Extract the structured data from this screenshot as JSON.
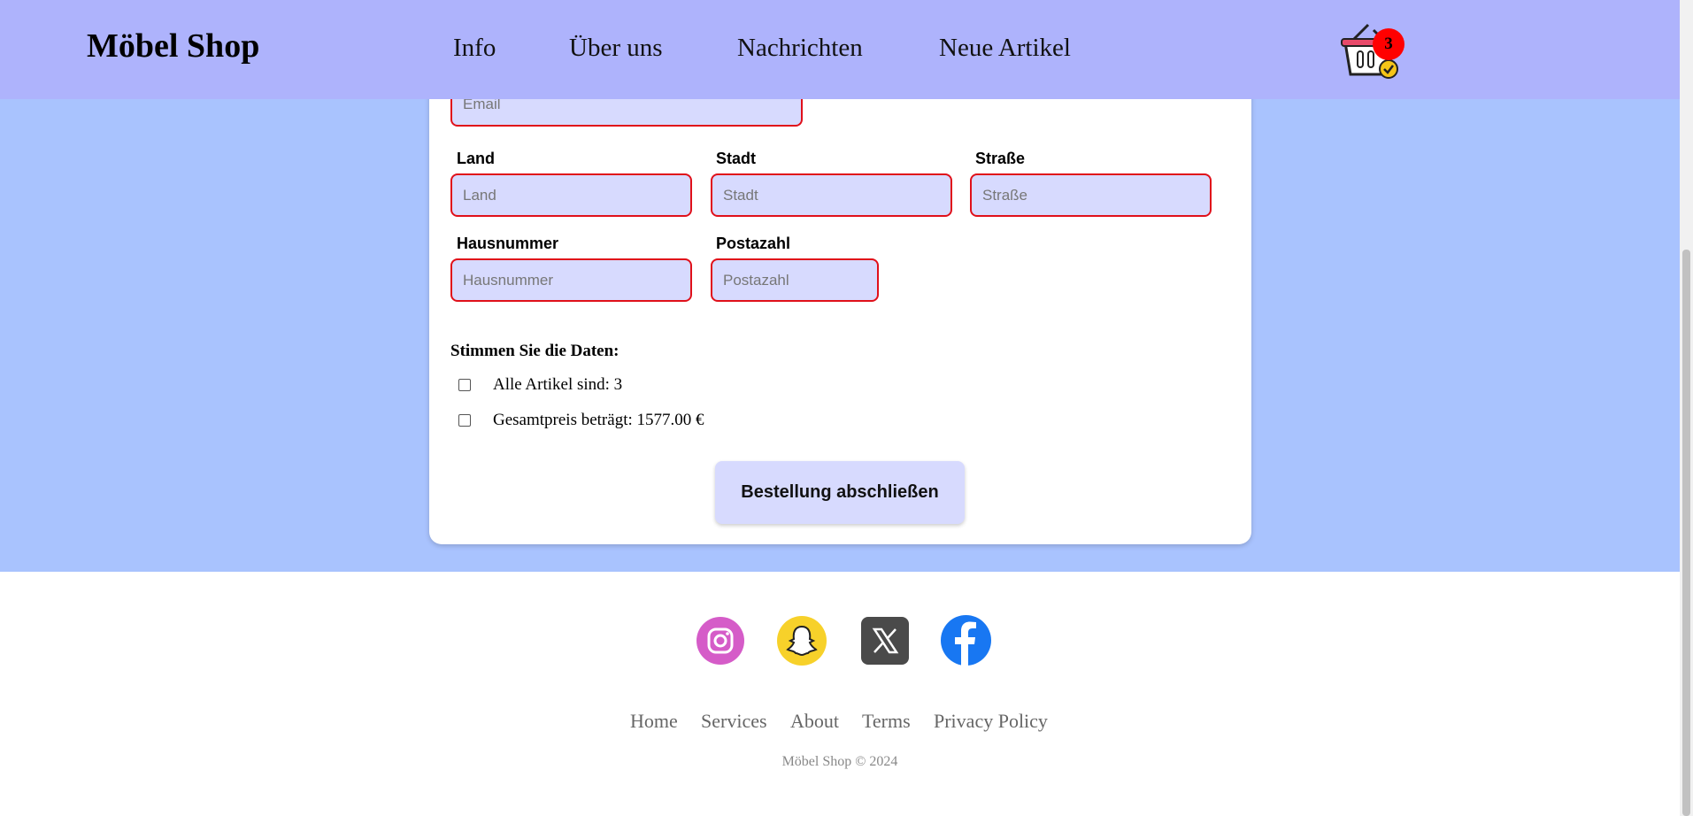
{
  "header": {
    "brand": "Möbel Shop",
    "nav": [
      "Info",
      "Über uns",
      "Nachrichten",
      "Neue Artikel"
    ],
    "cart_count": "3",
    "cart_icon": "shopping-basket-icon"
  },
  "form": {
    "email": {
      "placeholder": "Email",
      "value": ""
    },
    "land": {
      "label": "Land",
      "placeholder": "Land",
      "value": ""
    },
    "stadt": {
      "label": "Stadt",
      "placeholder": "Stadt",
      "value": ""
    },
    "strasse": {
      "label": "Straße",
      "placeholder": "Straße",
      "value": ""
    },
    "hausnummer": {
      "label": "Hausnummer",
      "placeholder": "Hausnummer",
      "value": ""
    },
    "postazahl": {
      "label": "Postazahl",
      "placeholder": "Postazahl",
      "value": ""
    },
    "confirm_title": "Stimmen Sie die Daten:",
    "checks": [
      {
        "label": "Alle Artikel sind: 3",
        "checked": false
      },
      {
        "label": "Gesamtpreis beträgt: 1577.00 €",
        "checked": false
      }
    ],
    "submit_label": "Bestellung abschließen"
  },
  "footer": {
    "social": [
      "instagram-icon",
      "snapchat-icon",
      "x-twitter-icon",
      "facebook-icon"
    ],
    "links": [
      "Home",
      "Services",
      "About",
      "Terms",
      "Privacy Policy"
    ],
    "copyright": "Möbel Shop © 2024"
  },
  "colors": {
    "header_bg": "#aeb3fc",
    "main_bg": "#a9c3fe",
    "field_bg": "#d7dafe",
    "field_border": "#e0101a",
    "badge": "#ff0000",
    "instagram": "#d55cc8",
    "snapchat": "#f7d12a",
    "x": "#4a4a4a",
    "facebook": "#1877f2"
  }
}
